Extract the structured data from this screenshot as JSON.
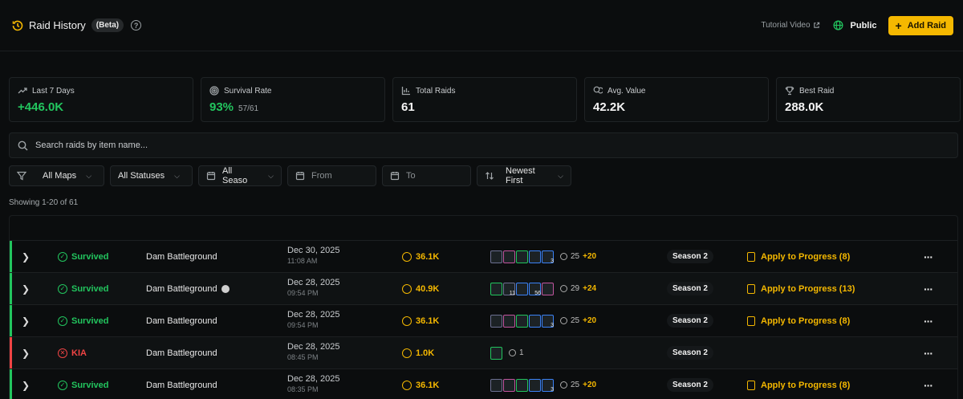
{
  "header": {
    "title": "Raid History",
    "badge": "(Beta)",
    "help_icon": "?",
    "tutorial": "Tutorial Video",
    "visibility": "Public",
    "add_button": "Add Raid"
  },
  "stats": [
    {
      "icon": "trend-up-icon",
      "label": "Last 7 Days",
      "value": "+446.0K",
      "sub": "",
      "green": true
    },
    {
      "icon": "target-icon",
      "label": "Survival Rate",
      "value": "93%",
      "sub": "57/61",
      "green": true
    },
    {
      "icon": "bar-chart-icon",
      "label": "Total Raids",
      "value": "61",
      "sub": "",
      "green": false
    },
    {
      "icon": "coins-icon",
      "label": "Avg. Value",
      "value": "42.2K",
      "sub": "",
      "green": false
    },
    {
      "icon": "trophy-icon",
      "label": "Best Raid",
      "value": "288.0K",
      "sub": "",
      "green": false
    }
  ],
  "search": {
    "placeholder": "Search raids by item name..."
  },
  "filters": {
    "maps": "All Maps",
    "statuses": "All Statuses",
    "seasons": "All Seaso",
    "from": "From",
    "to": "To",
    "sort": "Newest First"
  },
  "showing": "Showing 1-20 of 61",
  "colors": {
    "accent": "#f5b800",
    "survived": "#22c55e",
    "kia": "#ef4444"
  },
  "rows": [
    {
      "status": "Survived",
      "status_type": "survived",
      "map": "Dam Battleground",
      "map_icon": false,
      "date": "Dec 30, 2025",
      "time": "11:08 AM",
      "value": "36.1K",
      "items": [
        {
          "color": "#6b6f90",
          "cnt": ""
        },
        {
          "color": "#c2559f",
          "cnt": ""
        },
        {
          "color": "#22c55e",
          "cnt": ""
        },
        {
          "color": "#3b82f6",
          "cnt": ""
        },
        {
          "color": "#3b82f6",
          "cnt": "3"
        }
      ],
      "item_count": "25",
      "item_plus": "+20",
      "season": "Season 2",
      "apply": "Apply to Progress (8)"
    },
    {
      "status": "Survived",
      "status_type": "survived",
      "map": "Dam Battleground",
      "map_icon": true,
      "date": "Dec 28, 2025",
      "time": "09:54 PM",
      "value": "40.9K",
      "items": [
        {
          "color": "#22c55e",
          "cnt": ""
        },
        {
          "color": "#6b6f90",
          "cnt": "11"
        },
        {
          "color": "#3b82f6",
          "cnt": ""
        },
        {
          "color": "#3b82f6",
          "cnt": "56"
        },
        {
          "color": "#c2559f",
          "cnt": ""
        }
      ],
      "item_count": "29",
      "item_plus": "+24",
      "season": "Season 2",
      "apply": "Apply to Progress (13)"
    },
    {
      "status": "Survived",
      "status_type": "survived",
      "map": "Dam Battleground",
      "map_icon": false,
      "date": "Dec 28, 2025",
      "time": "09:54 PM",
      "value": "36.1K",
      "items": [
        {
          "color": "#6b6f90",
          "cnt": ""
        },
        {
          "color": "#c2559f",
          "cnt": ""
        },
        {
          "color": "#22c55e",
          "cnt": ""
        },
        {
          "color": "#3b82f6",
          "cnt": ""
        },
        {
          "color": "#3b82f6",
          "cnt": "3"
        }
      ],
      "item_count": "25",
      "item_plus": "+20",
      "season": "Season 2",
      "apply": "Apply to Progress (8)"
    },
    {
      "status": "KIA",
      "status_type": "kia",
      "map": "Dam Battleground",
      "map_icon": false,
      "date": "Dec 28, 2025",
      "time": "08:45 PM",
      "value": "1.0K",
      "items": [
        {
          "color": "#22c55e",
          "cnt": ""
        }
      ],
      "item_count": "1",
      "item_plus": "",
      "season": "Season 2",
      "apply": ""
    },
    {
      "status": "Survived",
      "status_type": "survived",
      "map": "Dam Battleground",
      "map_icon": false,
      "date": "Dec 28, 2025",
      "time": "08:35 PM",
      "value": "36.1K",
      "items": [
        {
          "color": "#6b6f90",
          "cnt": ""
        },
        {
          "color": "#c2559f",
          "cnt": ""
        },
        {
          "color": "#22c55e",
          "cnt": ""
        },
        {
          "color": "#3b82f6",
          "cnt": ""
        },
        {
          "color": "#3b82f6",
          "cnt": "3"
        }
      ],
      "item_count": "25",
      "item_plus": "+20",
      "season": "Season 2",
      "apply": "Apply to Progress (8)"
    }
  ]
}
